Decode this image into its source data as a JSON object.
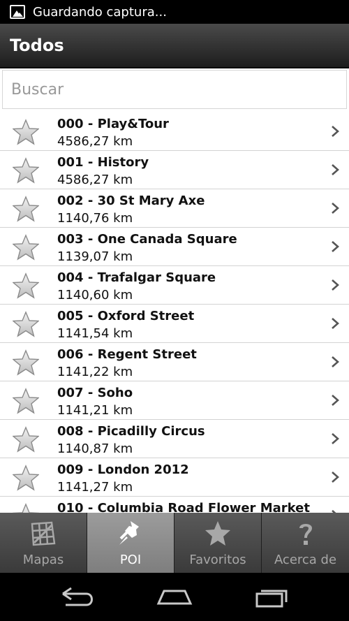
{
  "status_bar": {
    "text": "Guardando captura...",
    "icon": "image-icon"
  },
  "action_bar": {
    "title": "Todos"
  },
  "search": {
    "placeholder": "Buscar",
    "value": ""
  },
  "items": [
    {
      "title": "000 - Play&Tour",
      "distance": "4586,27 km"
    },
    {
      "title": "001 - History",
      "distance": "4586,27 km"
    },
    {
      "title": "002 - 30 St Mary Axe",
      "distance": "1140,76 km"
    },
    {
      "title": "003 - One Canada Square",
      "distance": "1139,07 km"
    },
    {
      "title": "004 - Trafalgar Square",
      "distance": "1140,60 km"
    },
    {
      "title": "005 - Oxford Street",
      "distance": "1141,54 km"
    },
    {
      "title": "006 - Regent Street",
      "distance": "1141,22 km"
    },
    {
      "title": "007 - Soho",
      "distance": "1141,21 km"
    },
    {
      "title": "008 - Picadilly Circus",
      "distance": "1140,87 km"
    },
    {
      "title": "009 - London 2012",
      "distance": "1141,27 km"
    },
    {
      "title": "010 - Columbia Road Flower Market",
      "distance": ""
    }
  ],
  "tabs": [
    {
      "label": "Mapas",
      "icon": "map-icon",
      "active": false
    },
    {
      "label": "POI",
      "icon": "pushpin-icon",
      "active": true
    },
    {
      "label": "Favoritos",
      "icon": "star-icon",
      "active": false
    },
    {
      "label": "Acerca de",
      "icon": "question-icon",
      "active": false
    }
  ],
  "nav": {
    "back": "back-icon",
    "home": "home-icon",
    "recents": "recent-apps-icon"
  },
  "colors": {
    "action_bar": "#2d2d2d",
    "active_tab": "#8c8c8c",
    "tab": "#474747",
    "divider": "#d3d3d3"
  }
}
